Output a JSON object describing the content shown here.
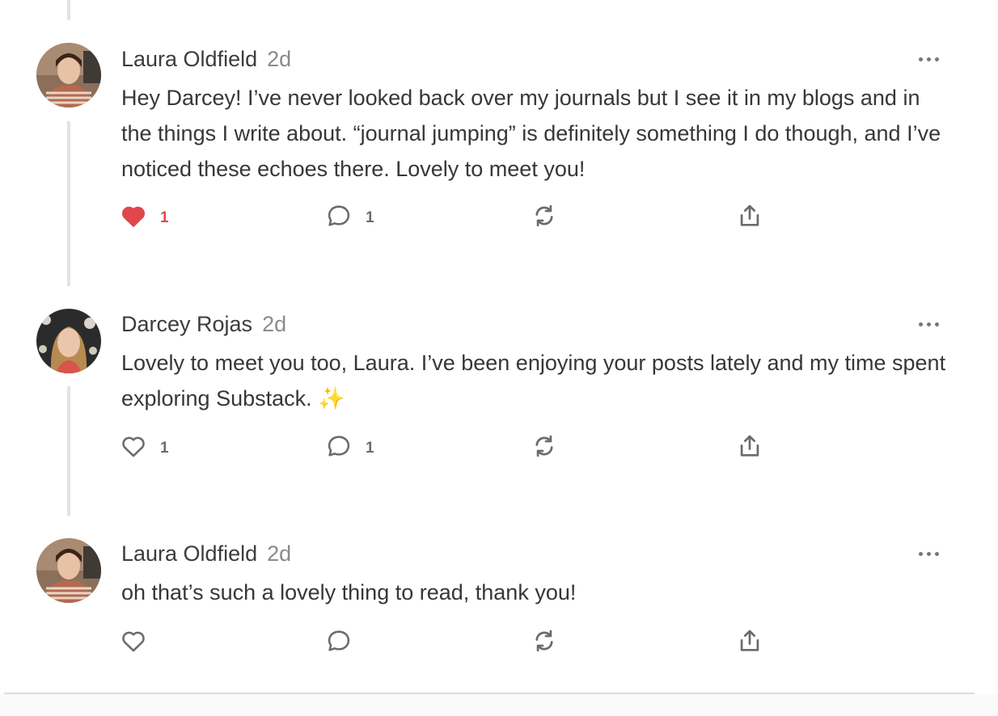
{
  "comments": [
    {
      "author": "Laura Oldfield",
      "time": "2d",
      "body": "Hey Darcey! I’ve never looked back over my journals but I see it in my blogs and in the things I write about. “journal jumping” is definitely something I do though, and I’ve noticed these echoes there. Lovely to meet you!",
      "likes": "1",
      "liked": true,
      "replies": "1"
    },
    {
      "author": "Darcey Rojas",
      "time": "2d",
      "body": "Lovely to meet you too, Laura. I’ve been enjoying your posts lately and my time spent exploring Substack. ✨",
      "likes": "1",
      "liked": false,
      "replies": "1"
    },
    {
      "author": "Laura Oldfield",
      "time": "2d",
      "body": "oh that’s such a lovely thing to read, thank you!",
      "likes": "",
      "liked": false,
      "replies": ""
    }
  ],
  "icons": {
    "like": "heart-icon",
    "reply": "comment-bubble-icon",
    "restack": "restack-icon",
    "share": "share-icon",
    "more": "ellipsis-icon"
  },
  "colors": {
    "liked": "#e0474c",
    "icon": "#6b6b6b",
    "thread_line": "#e3e3e3"
  }
}
